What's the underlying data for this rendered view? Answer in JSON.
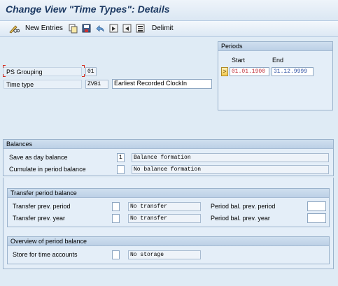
{
  "window": {
    "title": "Change View \"Time Types\": Details"
  },
  "toolbar": {
    "new_entries_label": "New Entries",
    "delimit_label": "Delimit",
    "icons": [
      "pencil-glasses-icon",
      "copy-icon",
      "save-as-icon",
      "undo-icon",
      "next-entry-icon",
      "previous-entry-icon",
      "select-block-icon",
      "delimit-icon"
    ]
  },
  "header": {
    "ps_grouping_label": "PS Grouping",
    "ps_grouping_value": "01",
    "time_type_label": "Time type",
    "time_type_value": "ZVB1",
    "time_type_text": "Earliest Recorded ClockIn"
  },
  "periods": {
    "title": "Periods",
    "start_label": "Start",
    "end_label": "End",
    "start_value": "01.01.1900",
    "end_value": "31.12.9999",
    "nav_symbol": ">"
  },
  "balances": {
    "title": "Balances",
    "save_day_label": "Save as day balance",
    "save_day_value": "1",
    "save_day_text": "Balance formation",
    "cumulate_label": "Cumulate in period balance",
    "cumulate_value": "",
    "cumulate_text": "No balance formation"
  },
  "transfer": {
    "title": "Transfer period balance",
    "prev_period_label": "Transfer prev. period",
    "prev_period_value": "",
    "prev_period_text": "No transfer",
    "prev_year_label": "Transfer prev. year",
    "prev_year_value": "",
    "prev_year_text": "No transfer",
    "bal_prev_period_label": "Period bal. prev. period",
    "bal_prev_period_value": "",
    "bal_prev_year_label": "Period bal. prev. year",
    "bal_prev_year_value": ""
  },
  "overview": {
    "title": "Overview of period balance",
    "store_label": "Store for time accounts",
    "store_value": "",
    "store_text": "No storage"
  },
  "colors": {
    "title": "#1d3a63",
    "start_date": "#c0303b",
    "end_date": "#2c4fa3",
    "background": "#dfebf5"
  }
}
